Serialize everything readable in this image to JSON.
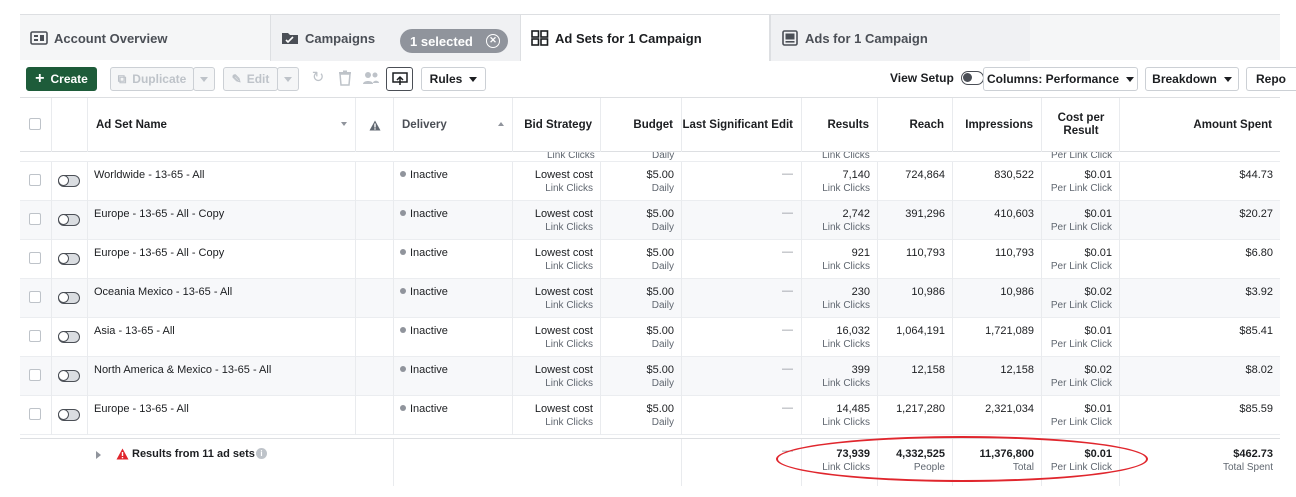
{
  "tabs": {
    "account_overview": "Account Overview",
    "campaigns": "Campaigns",
    "selected_pill": "1 selected",
    "ad_sets": "Ad Sets for 1 Campaign",
    "ads": "Ads for 1 Campaign"
  },
  "toolbar": {
    "create": "Create",
    "duplicate": "Duplicate",
    "edit": "Edit",
    "rules": "Rules",
    "view_setup": "View Setup",
    "columns": "Columns: Performance",
    "breakdown": "Breakdown",
    "reports": "Repo"
  },
  "columns": {
    "name": "Ad Set Name",
    "delivery": "Delivery",
    "bid_strategy": "Bid Strategy",
    "budget": "Budget",
    "last_edit": "Last Significant Edit",
    "results": "Results",
    "reach": "Reach",
    "impressions": "Impressions",
    "cost_per_result": "Cost per Result",
    "amount_spent": "Amount Spent"
  },
  "partial_row": {
    "bid_sub": "Link Clicks",
    "budget_sub": "Daily",
    "results_sub": "Link Clicks",
    "cost_sub": "Per Link Click"
  },
  "rows": [
    {
      "name": "Worldwide - 13-65 - All",
      "delivery": "Inactive",
      "bid": "Lowest cost",
      "bid_sub": "Link Clicks",
      "budget": "$5.00",
      "budget_sub": "Daily",
      "last_edit": "—",
      "results": "7,140",
      "results_sub": "Link Clicks",
      "reach": "724,864",
      "impressions": "830,522",
      "cost": "$0.01",
      "cost_sub": "Per Link Click",
      "spent": "$44.73"
    },
    {
      "name": "Europe - 13-65 - All - Copy",
      "delivery": "Inactive",
      "bid": "Lowest cost",
      "bid_sub": "Link Clicks",
      "budget": "$5.00",
      "budget_sub": "Daily",
      "last_edit": "—",
      "results": "2,742",
      "results_sub": "Link Clicks",
      "reach": "391,296",
      "impressions": "410,603",
      "cost": "$0.01",
      "cost_sub": "Per Link Click",
      "spent": "$20.27"
    },
    {
      "name": "Europe - 13-65 - All - Copy",
      "delivery": "Inactive",
      "bid": "Lowest cost",
      "bid_sub": "Link Clicks",
      "budget": "$5.00",
      "budget_sub": "Daily",
      "last_edit": "—",
      "results": "921",
      "results_sub": "Link Clicks",
      "reach": "110,793",
      "impressions": "110,793",
      "cost": "$0.01",
      "cost_sub": "Per Link Click",
      "spent": "$6.80"
    },
    {
      "name": "Oceania Mexico - 13-65 - All",
      "delivery": "Inactive",
      "bid": "Lowest cost",
      "bid_sub": "Link Clicks",
      "budget": "$5.00",
      "budget_sub": "Daily",
      "last_edit": "—",
      "results": "230",
      "results_sub": "Link Clicks",
      "reach": "10,986",
      "impressions": "10,986",
      "cost": "$0.02",
      "cost_sub": "Per Link Click",
      "spent": "$3.92"
    },
    {
      "name": "Asia - 13-65 - All",
      "delivery": "Inactive",
      "bid": "Lowest cost",
      "bid_sub": "Link Clicks",
      "budget": "$5.00",
      "budget_sub": "Daily",
      "last_edit": "—",
      "results": "16,032",
      "results_sub": "Link Clicks",
      "reach": "1,064,191",
      "impressions": "1,721,089",
      "cost": "$0.01",
      "cost_sub": "Per Link Click",
      "spent": "$85.41"
    },
    {
      "name": "North America & Mexico - 13-65 - All",
      "delivery": "Inactive",
      "bid": "Lowest cost",
      "bid_sub": "Link Clicks",
      "budget": "$5.00",
      "budget_sub": "Daily",
      "last_edit": "—",
      "results": "399",
      "results_sub": "Link Clicks",
      "reach": "12,158",
      "impressions": "12,158",
      "cost": "$0.02",
      "cost_sub": "Per Link Click",
      "spent": "$8.02"
    },
    {
      "name": "Europe - 13-65 - All",
      "delivery": "Inactive",
      "bid": "Lowest cost",
      "bid_sub": "Link Clicks",
      "budget": "$5.00",
      "budget_sub": "Daily",
      "last_edit": "—",
      "results": "14,485",
      "results_sub": "Link Clicks",
      "reach": "1,217,280",
      "impressions": "2,321,034",
      "cost": "$0.01",
      "cost_sub": "Per Link Click",
      "spent": "$85.59"
    }
  ],
  "summary": {
    "label": "Results from 11 ad sets",
    "last_edit": "—",
    "results": "73,939",
    "results_sub": "Link Clicks",
    "reach": "4,332,525",
    "reach_sub": "People",
    "impressions": "11,376,800",
    "impressions_sub": "Total",
    "cost": "$0.01",
    "cost_sub": "Per Link Click",
    "spent": "$462.73",
    "spent_sub": "Total Spent"
  },
  "colors": {
    "create_button": "#1e5c3a",
    "highlight_ellipse": "#e0262d",
    "warning_icon": "#e0262d"
  }
}
